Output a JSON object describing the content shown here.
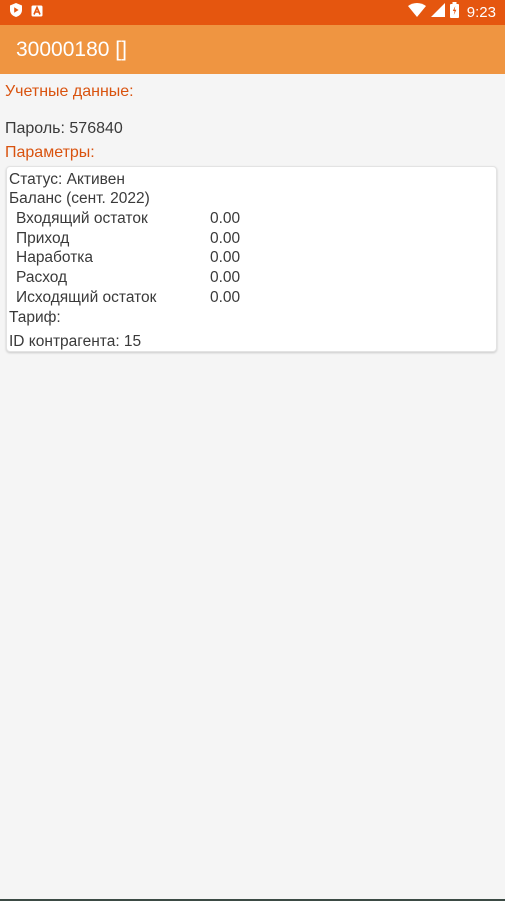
{
  "status_bar": {
    "time": "9:23",
    "background_color": "#e5560f",
    "icons_left": [
      "shield-icon",
      "a-letter-icon"
    ],
    "icons_right": [
      "wifi-icon",
      "signal-icon",
      "battery-icon"
    ]
  },
  "app_bar": {
    "title": "30000180 []",
    "background_color": "#ef9541"
  },
  "account": {
    "section_title": "Учетные данные:",
    "password": "Пароль: 576840"
  },
  "params": {
    "section_title": "Параметры:",
    "status": "Статус: Активен",
    "balance_title": "Баланс (сент. 2022)",
    "rows": [
      {
        "label": "Входящий остаток",
        "value": "0.00"
      },
      {
        "label": "Приход",
        "value": "0.00"
      },
      {
        "label": "Наработка",
        "value": "0.00"
      },
      {
        "label": "Расход",
        "value": "0.00"
      },
      {
        "label": "Исходящий остаток",
        "value": "0.00"
      }
    ],
    "tariff": "Тариф:",
    "contractor_id": "ID контрагента:  15"
  },
  "colors": {
    "accent_text": "#d9530f",
    "body_text": "#3a3a3a"
  }
}
